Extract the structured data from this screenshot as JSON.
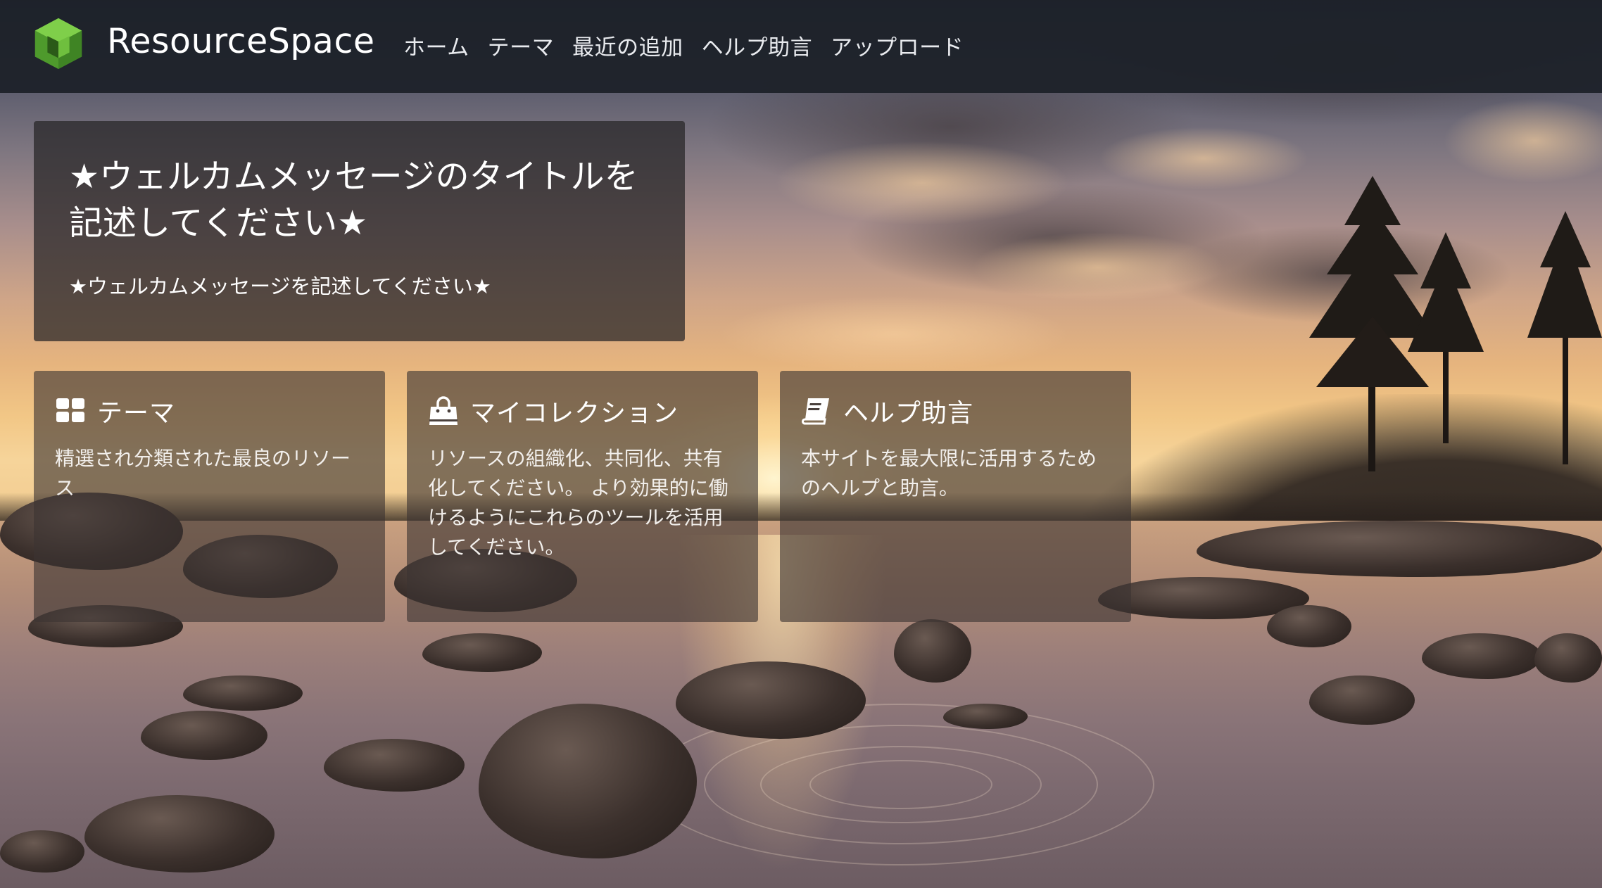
{
  "header": {
    "logo_text": "ResourceSpace",
    "logo_icon": "resourcespace-cube-icon",
    "brand_color": "#6dbb3f",
    "nav": [
      {
        "label": "ホーム"
      },
      {
        "label": "テーマ"
      },
      {
        "label": "最近の追加"
      },
      {
        "label": "ヘルプ助言"
      },
      {
        "label": "アップロード"
      }
    ]
  },
  "welcome": {
    "title": "★ウェルカムメッセージのタイトルを記述してください★",
    "text": "★ウェルカムメッセージを記述してください★"
  },
  "tiles": [
    {
      "icon": "grid-icon",
      "title": "テーマ",
      "text": "精選され分類された最良のリソース"
    },
    {
      "icon": "shopping-bag-icon",
      "title": "マイコレクション",
      "text": "リソースの組織化、共同化、共有化してください。 より効果的に働けるようにこれらのツールを活用してください。"
    },
    {
      "icon": "book-icon",
      "title": "ヘルプ助言",
      "text": "本サイトを最大限に活用するためのヘルプと助言。"
    }
  ]
}
